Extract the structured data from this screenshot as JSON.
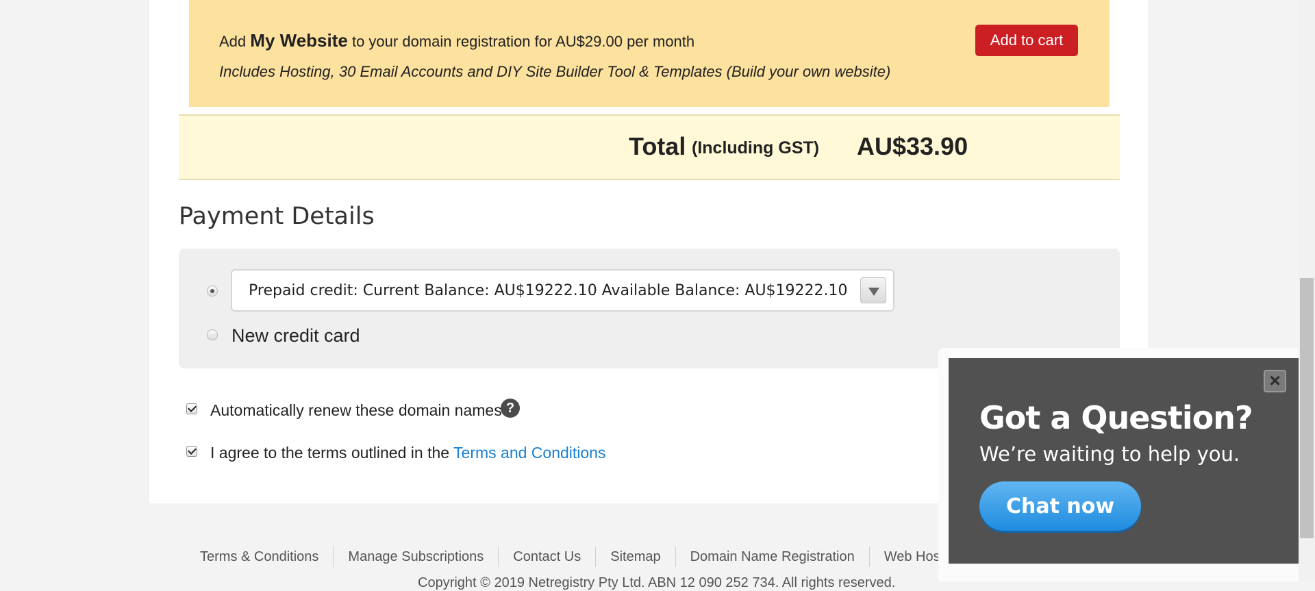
{
  "upsell": {
    "add_word": "Add",
    "product": "My Website",
    "line1_rest": "to your domain registration for AU$29.00 per month",
    "line2": "Includes Hosting, 30 Email Accounts and DIY Site Builder Tool & Templates (Build your own website)",
    "button_label": "Add to cart",
    "background_color": "#fde19e",
    "button_color": "#cc1f24"
  },
  "total": {
    "label": "Total",
    "note": "(Including GST)",
    "value": "AU$33.90"
  },
  "payment": {
    "section_title": "Payment Details",
    "prepaid_option": "Prepaid credit: Current Balance: AU$19222.10 Available Balance: AU$19222.10",
    "new_card_label": "New credit card",
    "selected": "prepaid"
  },
  "options": {
    "auto_renew_label": "Automatically renew these domain names",
    "auto_renew_checked": true,
    "agree_label": "I agree to the terms outlined in the",
    "terms_link": "Terms and Conditions",
    "agree_checked": true
  },
  "footer": {
    "links": [
      "Terms & Conditions",
      "Manage Subscriptions",
      "Contact Us",
      "Sitemap",
      "Domain Name Registration",
      "Web Hostin"
    ],
    "copyright": "Copyright © 2019 Netregistry Pty Ltd. ABN 12 090 252 734. All rights reserved."
  },
  "chat": {
    "title": "Got a Question?",
    "subtitle": "We’re waiting to help you.",
    "button_label": "Chat now",
    "close_icon": "close-icon",
    "button_color": "#2b93e3"
  }
}
